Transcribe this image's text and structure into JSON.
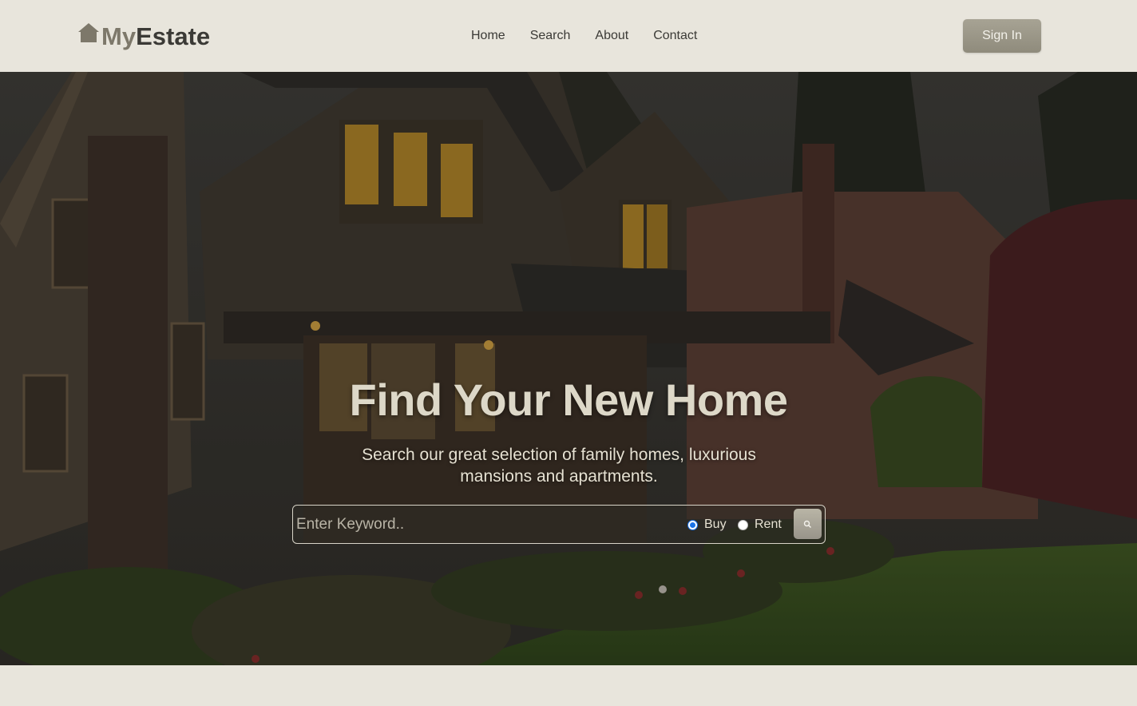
{
  "header": {
    "logo_my": "My",
    "logo_estate": "Estate",
    "nav": [
      "Home",
      "Search",
      "About",
      "Contact"
    ],
    "signin_label": "Sign In"
  },
  "hero": {
    "title": "Find Your New Home",
    "subtitle": "Search our great selection of family homes, luxurious mansions and apartments.",
    "search": {
      "placeholder": "Enter Keyword..",
      "value": "",
      "options": [
        {
          "label": "Buy",
          "checked": true
        },
        {
          "label": "Rent",
          "checked": false
        }
      ],
      "button_icon": "search-icon"
    }
  },
  "colors": {
    "page_bg": "#e8e5dc",
    "brand_light": "#7d786a",
    "brand_dark": "#3b3a36",
    "button": "#a7a394",
    "radio_accent": "#1a73e8"
  }
}
